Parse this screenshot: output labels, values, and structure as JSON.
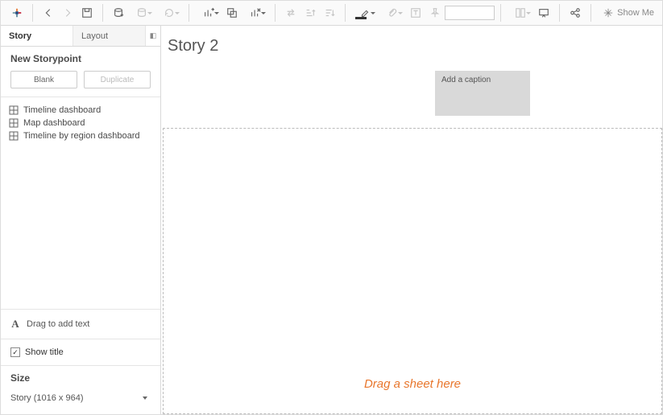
{
  "toolbar": {
    "showme_label": "Show Me"
  },
  "sidebar": {
    "tabs": {
      "story": "Story",
      "layout": "Layout"
    },
    "new_storypoint_title": "New Storypoint",
    "buttons": {
      "blank": "Blank",
      "duplicate": "Duplicate"
    },
    "dashboards": [
      {
        "label": "Timeline dashboard"
      },
      {
        "label": "Map dashboard"
      },
      {
        "label": "Timeline by region dashboard"
      }
    ],
    "drag_text": "Drag to add text",
    "show_title_label": "Show title",
    "show_title_checked": true,
    "size_title": "Size",
    "size_value": "Story (1016 x 964)"
  },
  "canvas": {
    "title": "Story 2",
    "caption_placeholder": "Add a caption",
    "drop_hint": "Drag a sheet here"
  }
}
